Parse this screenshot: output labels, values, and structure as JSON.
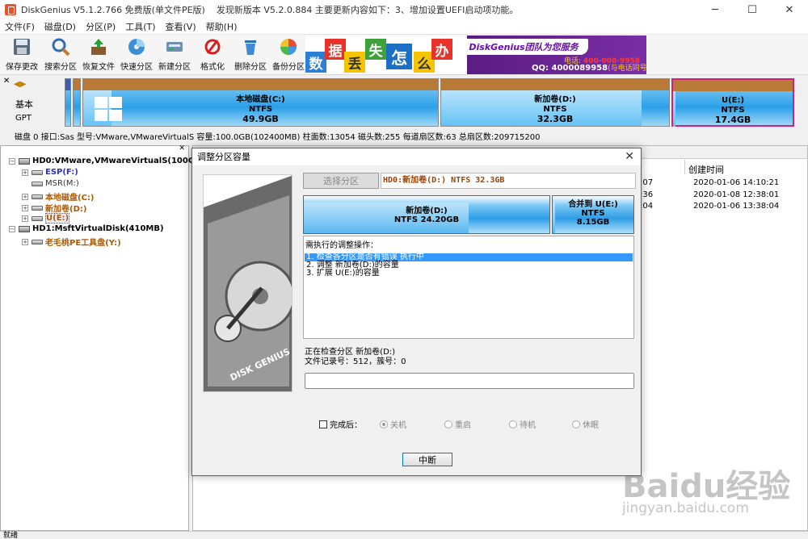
{
  "window": {
    "title": "DiskGenius V5.1.2.766 免费版(单文件PE版)",
    "notice": "发现新版本 V5.2.0.884 主要更新内容如下：3、增加设置UEFI启动项功能。",
    "minimize": "─",
    "maximize": "☐",
    "close": "✕"
  },
  "menu": [
    "文件(F)",
    "磁盘(D)",
    "分区(P)",
    "工具(T)",
    "查看(V)",
    "帮助(H)"
  ],
  "toolbar": [
    {
      "label": "保存更改",
      "icon": "save-icon"
    },
    {
      "label": "搜索分区",
      "icon": "magnifier-icon"
    },
    {
      "label": "恢复文件",
      "icon": "recover-icon"
    },
    {
      "label": "快速分区",
      "icon": "disc-icon"
    },
    {
      "label": "新建分区",
      "icon": "new-partition-icon"
    },
    {
      "label": "格式化",
      "icon": "format-icon"
    },
    {
      "label": "删除分区",
      "icon": "trash-icon"
    },
    {
      "label": "备份分区",
      "icon": "backup-icon"
    }
  ],
  "banner": {
    "chars": [
      "数",
      "据",
      "丢",
      "失",
      "怎",
      "么",
      "办"
    ],
    "slogan": "DiskGenius团队为您服务",
    "tel_prefix": "电话:",
    "tel": "400-008-9958",
    "qq": "QQ: 4000089958",
    "qq_note": "(与电话同号)"
  },
  "diskmap": {
    "basic": "基本",
    "gpt": "GPT",
    "partitions": [
      {
        "name": "本地磁盘(C:)",
        "fs": "NTFS",
        "size": "49.9GB",
        "used_fraction": 0.08
      },
      {
        "name": "新加卷(D:)",
        "fs": "NTFS",
        "size": "32.3GB",
        "used_fraction": 0.88
      },
      {
        "name": "U(E:)",
        "fs": "NTFS",
        "size": "17.4GB",
        "used_fraction": 0.02
      }
    ],
    "info": "磁盘 0 接口:Sas  型号:VMware,VMwareVirtualS  容量:100.0GB(102400MB)  柱面数:13054  磁头数:255  每道扇区数:63  总扇区数:209715200"
  },
  "tree": {
    "disk0": "HD0:VMware,VMwareVirtualS(100GB)",
    "disk0_parts": [
      "ESP(F:)",
      "MSR(M:)",
      "本地磁盘(C:)",
      "新加卷(D:)",
      "U(E:)"
    ],
    "disk1": "HD1:MsftVirtualDisk(410MB)",
    "disk1_parts": [
      "老毛桃PE工具盘(Y:)"
    ]
  },
  "right": {
    "col_created": "创建时间",
    "rows": [
      {
        "frag": ":07",
        "time": "2020-01-06 14:10:21"
      },
      {
        "frag": ":36",
        "time": "2020-01-08 12:38:01"
      },
      {
        "frag": ":04",
        "time": "2020-01-06 13:38:04"
      }
    ]
  },
  "status": "就绪",
  "watermark": {
    "main": "Baidu经验",
    "sub": "jingyan.baidu.com"
  },
  "dialog": {
    "title": "调整分区容量",
    "select_btn": "选择分区",
    "partition": "HD0:新加卷(D:) NTFS 32.3GB",
    "left_part": {
      "name": "新加卷(D:)",
      "detail": "NTFS 24.20GB",
      "used_fraction": 0.67
    },
    "right_part": {
      "name": "合并到 U(E:)",
      "fs": "NTFS",
      "size": "8.15GB",
      "used_fraction": 0.03
    },
    "ops_header": "需执行的调整操作：",
    "ops": [
      "1. 检查各分区是否有错误    执行中",
      "2. 调整 新加卷(D:)的容量",
      "3. 扩展 U(E:)的容量"
    ],
    "status1": "正在检查分区 新加卷(D:)",
    "status2": "文件记录号：512，簇号：0",
    "progress": 0,
    "finish_label": "完成后：",
    "options": [
      "关机",
      "重启",
      "待机",
      "休眠"
    ],
    "abort_btn": "中断"
  }
}
